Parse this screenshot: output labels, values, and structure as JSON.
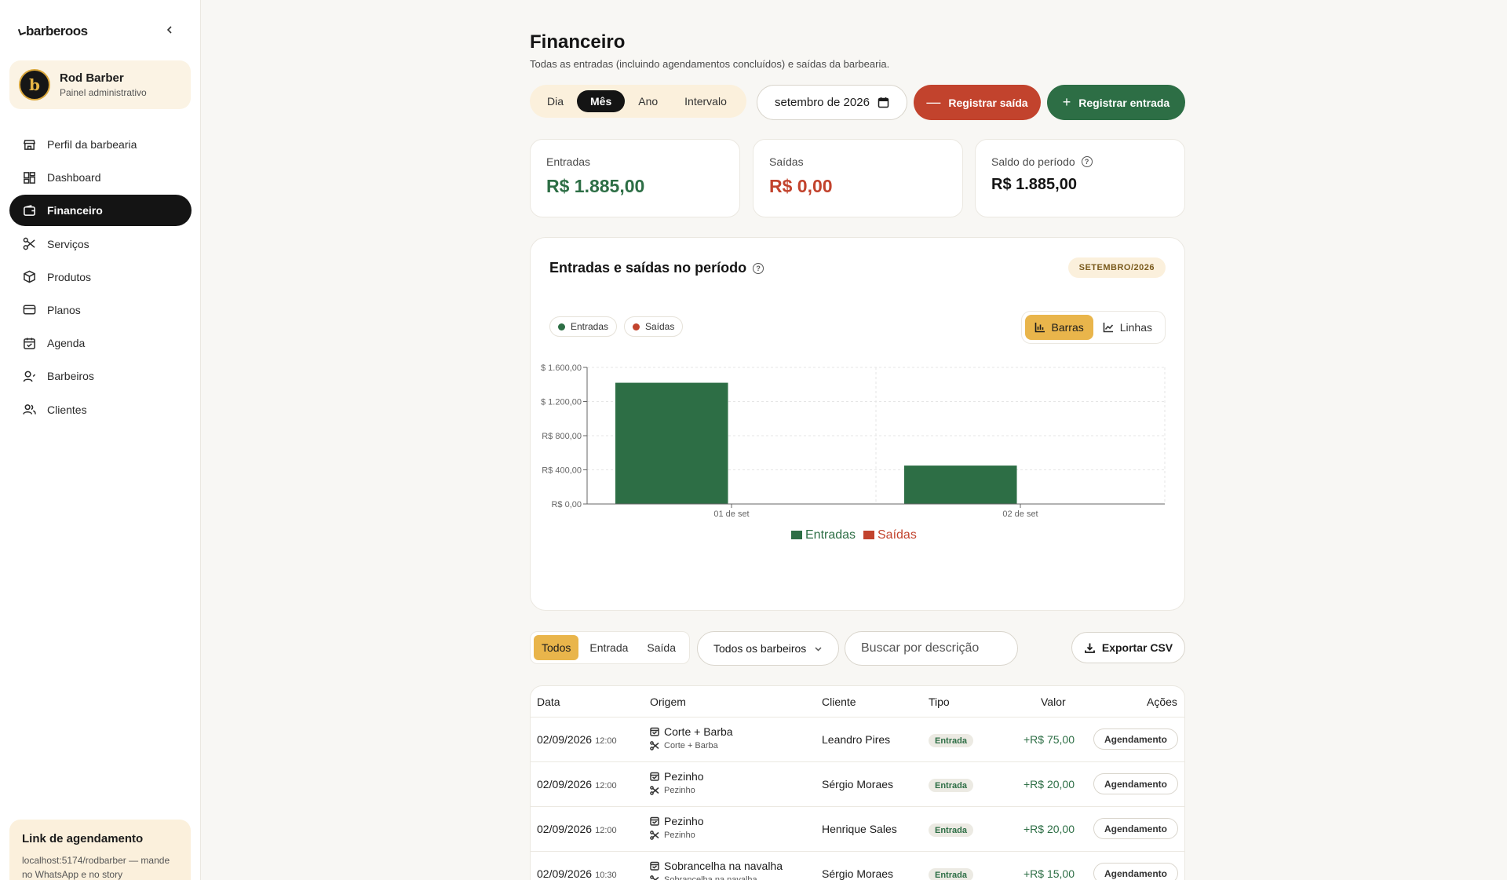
{
  "app": {
    "logo": "barberoos"
  },
  "profile": {
    "initial": "b",
    "name": "Rod Barber",
    "role": "Painel administrativo"
  },
  "nav": [
    {
      "label": "Perfil da barbearia",
      "icon": "store-icon"
    },
    {
      "label": "Dashboard",
      "icon": "dashboard-icon"
    },
    {
      "label": "Financeiro",
      "icon": "wallet-icon",
      "active": true
    },
    {
      "label": "Serviços",
      "icon": "scissors-icon"
    },
    {
      "label": "Produtos",
      "icon": "box-icon"
    },
    {
      "label": "Planos",
      "icon": "card-icon"
    },
    {
      "label": "Agenda",
      "icon": "calendar-icon"
    },
    {
      "label": "Barbeiros",
      "icon": "user-icon"
    },
    {
      "label": "Clientes",
      "icon": "users-icon"
    }
  ],
  "link_card": {
    "title": "Link de agendamento",
    "text": "localhost:5174/rodbarber — mande no WhatsApp e no story"
  },
  "header": {
    "title": "Financeiro",
    "subtitle": "Todas as entradas (incluindo agendamentos concluídos) e saídas da barbearia."
  },
  "period_tabs": [
    "Dia",
    "Mês",
    "Ano",
    "Intervalo"
  ],
  "period_active": "Mês",
  "date_value": "setembro de 2026",
  "actions": {
    "out": "Registrar saída",
    "in": "Registrar entrada"
  },
  "stats": [
    {
      "label": "Entradas",
      "value": "R$ 1.885,00",
      "tone": "green"
    },
    {
      "label": "Saídas",
      "value": "R$ 0,00",
      "tone": "red"
    },
    {
      "label": "Saldo do período",
      "value": "R$ 1.885,00",
      "tone": "dark"
    }
  ],
  "chart_card": {
    "title": "Entradas e saídas no período",
    "badge": "SETEMBRO/2026",
    "legend_pills": [
      "Entradas",
      "Saídas"
    ],
    "toggle": [
      "Barras",
      "Linhas"
    ],
    "toggle_active": "Barras"
  },
  "colors": {
    "entradas": "#2d6e45",
    "saidas": "#c2432d",
    "accent": "#e9b54b"
  },
  "chart_data": {
    "type": "bar",
    "categories": [
      "01 de set",
      "02 de set"
    ],
    "series": [
      {
        "name": "Entradas",
        "values": [
          1420,
          450
        ]
      },
      {
        "name": "Saídas",
        "values": [
          0,
          0
        ]
      }
    ],
    "ylim": [
      0,
      1600
    ],
    "yticks": [
      0,
      400,
      800,
      1200,
      1600
    ],
    "ytick_labels": [
      "R$ 0,00",
      "R$ 400,00",
      "R$ 800,00",
      "$ 1.200,00",
      "$ 1.600,00"
    ],
    "grid": true,
    "legend": "bottom"
  },
  "filters": {
    "types": [
      "Todos",
      "Entrada",
      "Saída"
    ],
    "active": "Todos",
    "barber": "Todos os barbeiros",
    "search_placeholder": "Buscar por descrição",
    "export": "Exportar CSV"
  },
  "table": {
    "headers": [
      "Data",
      "Origem",
      "Cliente",
      "Tipo",
      "Valor",
      "Ações"
    ],
    "rows": [
      {
        "date": "02/09/2026",
        "time": "12:00",
        "origin": "Corte + Barba",
        "service": "Corte + Barba",
        "client": "Leandro Pires",
        "type": "Entrada",
        "value": "+R$ 75,00",
        "action": "Agendamento"
      },
      {
        "date": "02/09/2026",
        "time": "12:00",
        "origin": "Pezinho",
        "service": "Pezinho",
        "client": "Sérgio Moraes",
        "type": "Entrada",
        "value": "+R$ 20,00",
        "action": "Agendamento"
      },
      {
        "date": "02/09/2026",
        "time": "12:00",
        "origin": "Pezinho",
        "service": "Pezinho",
        "client": "Henrique Sales",
        "type": "Entrada",
        "value": "+R$ 20,00",
        "action": "Agendamento"
      },
      {
        "date": "02/09/2026",
        "time": "10:30",
        "origin": "Sobrancelha na navalha",
        "service": "Sobrancelha na navalha",
        "client": "Sérgio Moraes",
        "type": "Entrada",
        "value": "+R$ 15,00",
        "action": "Agendamento"
      }
    ]
  }
}
